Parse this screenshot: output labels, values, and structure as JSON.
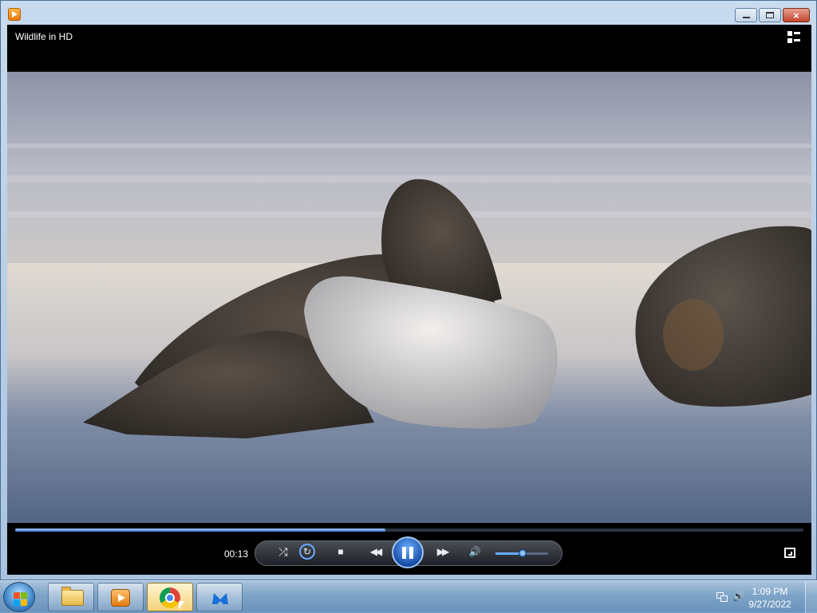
{
  "window": {
    "buttons": {
      "minimize": "minimize-icon",
      "maximize": "maximize-icon",
      "close": "close-icon"
    }
  },
  "player": {
    "title": "Wildlife in HD",
    "elapsed": "00:13",
    "progress": 0.47,
    "volume": 0.52
  },
  "controls": {
    "shuffle": "⤮",
    "repeat": "↻",
    "stop": "■",
    "previous": "◀◀",
    "next": "▶▶",
    "mute": "🔊"
  },
  "taskbar": {
    "apps": [
      "Windows Explorer",
      "Windows Media Player",
      "Google Chrome",
      "Malwarebytes"
    ],
    "time": "1:09 PM",
    "date": "9/27/2022"
  },
  "colors": {
    "accent": "#3c78c8",
    "taskbar": "#7ea4c8"
  }
}
